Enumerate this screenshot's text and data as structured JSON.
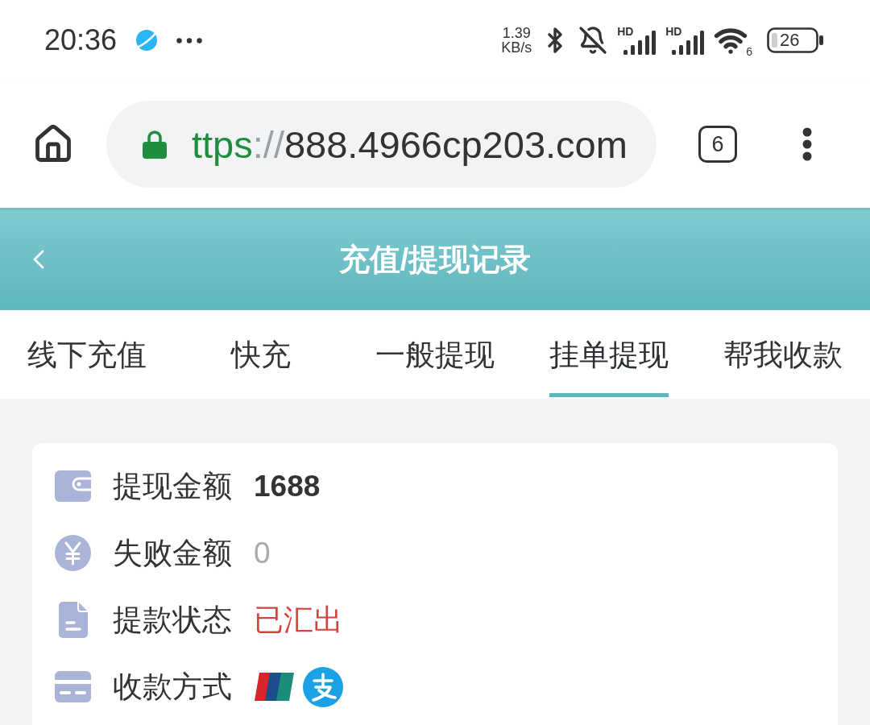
{
  "status_bar": {
    "time": "20:36",
    "network_speed": {
      "value": "1.39",
      "unit": "KB/s"
    },
    "signals": [
      {
        "label": "HD"
      },
      {
        "label": "HD"
      }
    ],
    "wifi_label": "6",
    "battery": "26"
  },
  "browser": {
    "url": {
      "scheme": "ttps",
      "separator": "://",
      "host": "888.4966cp203.com"
    },
    "tab_count": "6"
  },
  "header": {
    "title": "充值/提现记录"
  },
  "tabs": [
    {
      "label": "线下充值",
      "selected": false
    },
    {
      "label": "快充",
      "selected": false
    },
    {
      "label": "一般提现",
      "selected": false
    },
    {
      "label": "挂单提现",
      "selected": true
    },
    {
      "label": "帮我收款",
      "selected": false
    }
  ],
  "record": {
    "fields": [
      {
        "kind": "amount",
        "label": "提现金额",
        "value": "1688"
      },
      {
        "kind": "muted",
        "label": "失败金额",
        "value": "0"
      },
      {
        "kind": "status",
        "label": "提款状态",
        "value": "已汇出"
      },
      {
        "kind": "payment_methods",
        "label": "收款方式"
      }
    ]
  }
}
